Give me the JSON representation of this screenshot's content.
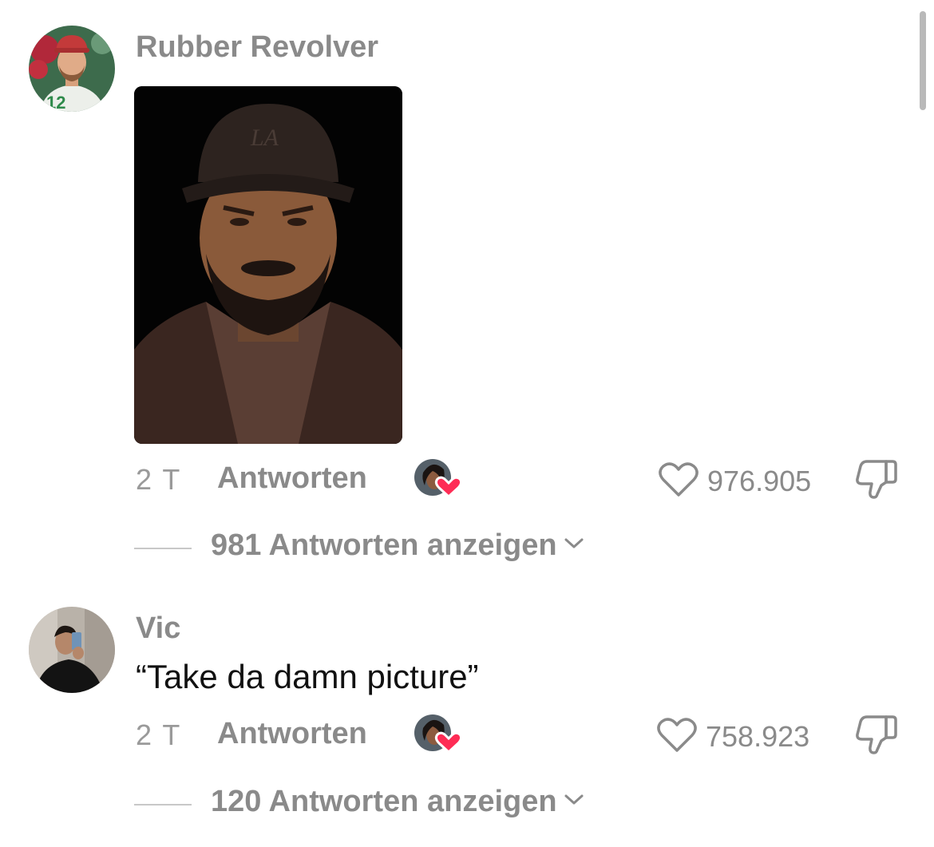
{
  "comments": [
    {
      "username": "Rubber Revolver",
      "avatar_icon": "profile-photo",
      "attachment": "image",
      "timestamp": "2 T",
      "reply_label": "Antworten",
      "creator_liked": true,
      "like_count": "976.905",
      "replies_label": "981 Antworten anzeigen"
    },
    {
      "username": "Vic",
      "avatar_icon": "profile-photo",
      "text": "“Take da damn picture”",
      "timestamp": "2 T",
      "reply_label": "Antworten",
      "creator_liked": true,
      "like_count": "758.923",
      "replies_label": "120 Antworten anzeigen"
    }
  ],
  "colors": {
    "secondary_text": "#8a8a8a",
    "primary_text": "#111111",
    "heart_badge": "#fe2c55",
    "divider": "#c8c8c8"
  }
}
